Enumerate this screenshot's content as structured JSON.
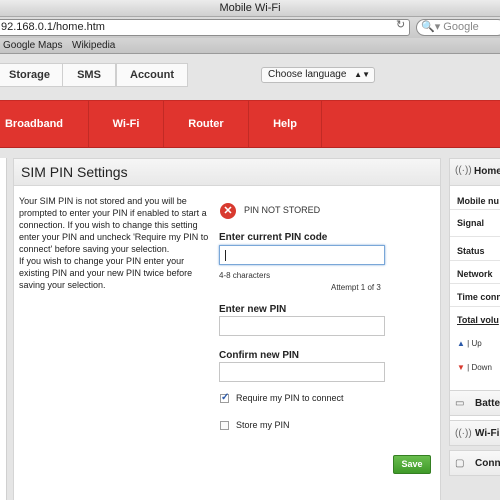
{
  "browser": {
    "window_title": "Mobile Wi-Fi",
    "url": "92.168.0.1/home.htm",
    "search_placeholder": "Google",
    "bookmarks": [
      "Google Maps",
      "Wikipedia"
    ]
  },
  "top_tabs": [
    "Storage",
    "SMS",
    "Account"
  ],
  "language_select": "Choose language",
  "nav": [
    "Broadband",
    "Wi-Fi",
    "Router",
    "Help"
  ],
  "panel": {
    "title": "SIM PIN Settings",
    "description_1": "Your SIM PIN is not stored and you will be prompted to enter your PIN if enabled to start a connection. If you wish to change this setting enter your PIN and uncheck 'Require my PIN to connect' before saving your selection.",
    "description_2": "If you wish to change your PIN enter your existing PIN and your new PIN twice before saving your selection.",
    "status": "PIN NOT STORED",
    "current_pin_label": "Enter current PIN code",
    "current_pin_value": "",
    "pin_hint": "4-8 characters",
    "attempt": "Attempt 1 of 3",
    "new_pin_label": "Enter new PIN",
    "new_pin_value": "",
    "confirm_pin_label": "Confirm new PIN",
    "confirm_pin_value": "",
    "require_pin_label": "Require my PIN to connect",
    "require_pin_checked": true,
    "store_pin_label": "Store my PIN",
    "store_pin_checked": false,
    "save_label": "Save"
  },
  "sidebar": {
    "home": "Home",
    "rows": [
      "Mobile nu",
      "Signal",
      "Status",
      "Network",
      "Time conn",
      "Total volu"
    ],
    "up": "| Up",
    "down": "| Down",
    "battery": "Batte",
    "wifi": "Wi-Fi",
    "connections": "Conn"
  },
  "colors": {
    "nav_red": "#e0342e",
    "save_green": "#4caf35",
    "error_red": "#d83a2f"
  }
}
